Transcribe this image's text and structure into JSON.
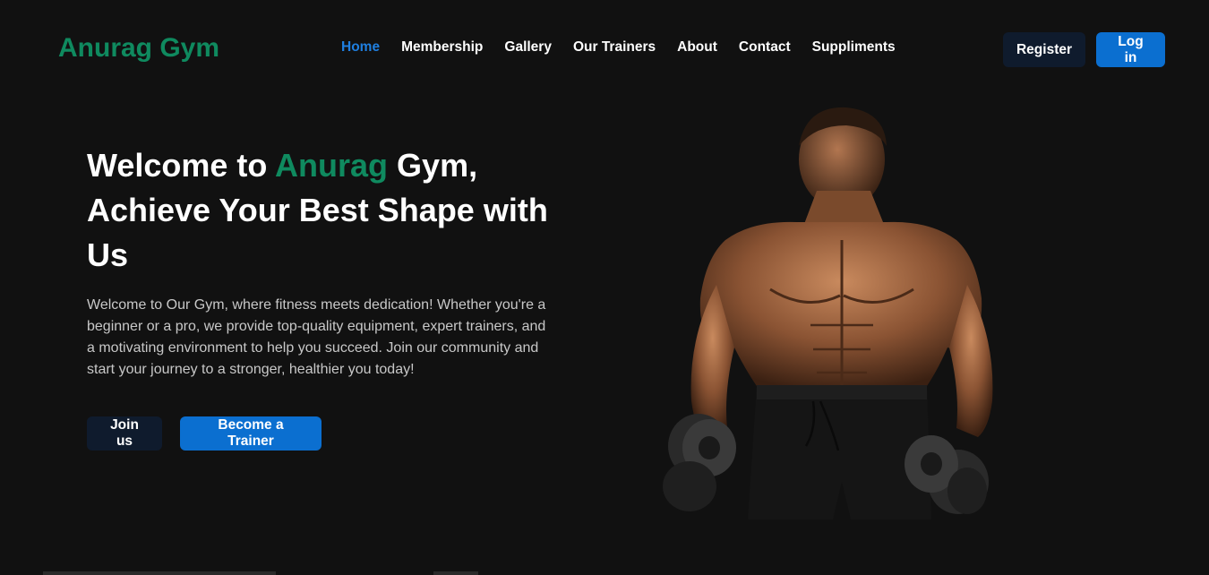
{
  "brand": {
    "name": "Anurag Gym",
    "color": "#0f8a5f"
  },
  "nav": {
    "items": [
      {
        "label": "Home",
        "active": true
      },
      {
        "label": "Membership"
      },
      {
        "label": "Gallery"
      },
      {
        "label": "Our Trainers"
      },
      {
        "label": "About"
      },
      {
        "label": "Contact"
      },
      {
        "label": "Suppliments"
      }
    ],
    "active_color": "#1f7fe0"
  },
  "auth": {
    "register_label": "Register",
    "login_label": "Log in"
  },
  "hero": {
    "title_prefix": "Welcome to ",
    "title_accent": "Anurag",
    "title_suffix": " Gym, Achieve Your Best Shape with Us",
    "description": "Welcome to Our Gym, where fitness meets dedication! Whether you're a beginner or a pro, we provide top-quality equipment, expert trainers, and a motivating environment to help you succeed. Join our community and start your journey to a stronger, healthier you today!",
    "join_label": "Join us",
    "trainer_label": "Become a Trainer",
    "image_icon": "bodybuilder-with-dumbbells-image"
  },
  "colors": {
    "background": "#111111",
    "primary_button": "#0b6fd0",
    "dark_button": "#0f1b2d"
  }
}
